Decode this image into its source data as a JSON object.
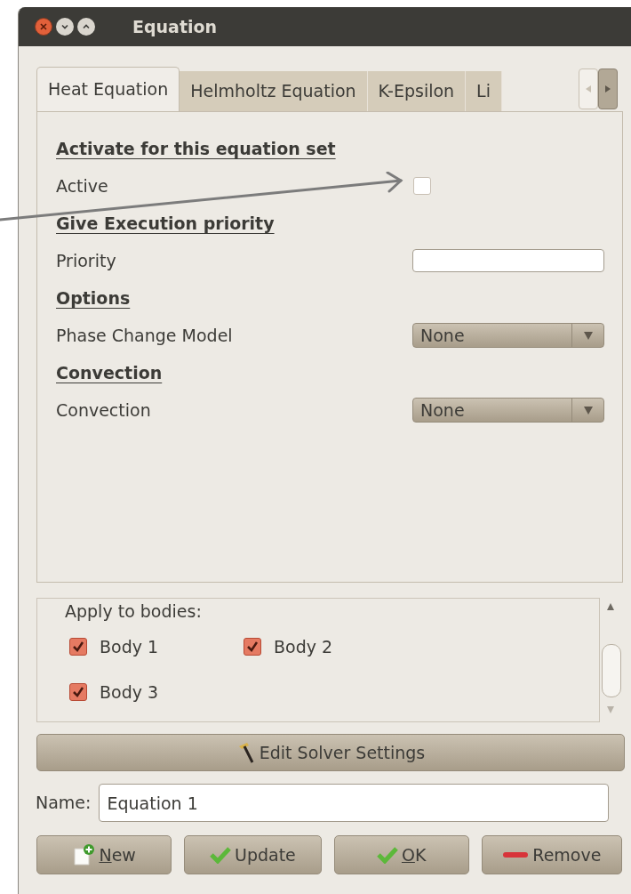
{
  "window": {
    "title": "Equation"
  },
  "tabs": [
    {
      "label": "Heat Equation",
      "selected": true
    },
    {
      "label": "Helmholtz Equation",
      "selected": false
    },
    {
      "label": "K-Epsilon",
      "selected": false
    },
    {
      "label": "Li",
      "selected": false
    }
  ],
  "form": [
    {
      "kind": "heading",
      "label": "Activate for this equation set"
    },
    {
      "kind": "checkbox",
      "label": "Active",
      "checked": false
    },
    {
      "kind": "heading",
      "label": "Give Execution priority"
    },
    {
      "kind": "text",
      "label": "Priority"
    },
    {
      "kind": "heading",
      "label": "Options"
    },
    {
      "kind": "dropdown",
      "label": "Phase Change Model",
      "value": "None"
    },
    {
      "kind": "heading",
      "label": "Convection"
    },
    {
      "kind": "dropdown",
      "label": "Convection",
      "value": "None"
    }
  ],
  "bodies": {
    "label": "Apply to bodies:",
    "items": [
      {
        "label": "Body 1",
        "checked": true
      },
      {
        "label": "Body 2",
        "checked": true
      },
      {
        "label": "Body 3",
        "checked": true
      }
    ]
  },
  "solver_button": "Edit Solver Settings",
  "name_field": {
    "label": "Name:",
    "value": "Equation 1"
  },
  "buttons": [
    {
      "kind": "new",
      "label": "New",
      "mnemonic_underlined": true
    },
    {
      "kind": "update",
      "label": "Update",
      "mnemonic_underlined": false
    },
    {
      "kind": "ok",
      "label": "OK",
      "mnemonic_underlined": true
    },
    {
      "kind": "remove",
      "label": "Remove",
      "mnemonic_underlined": false
    }
  ]
}
